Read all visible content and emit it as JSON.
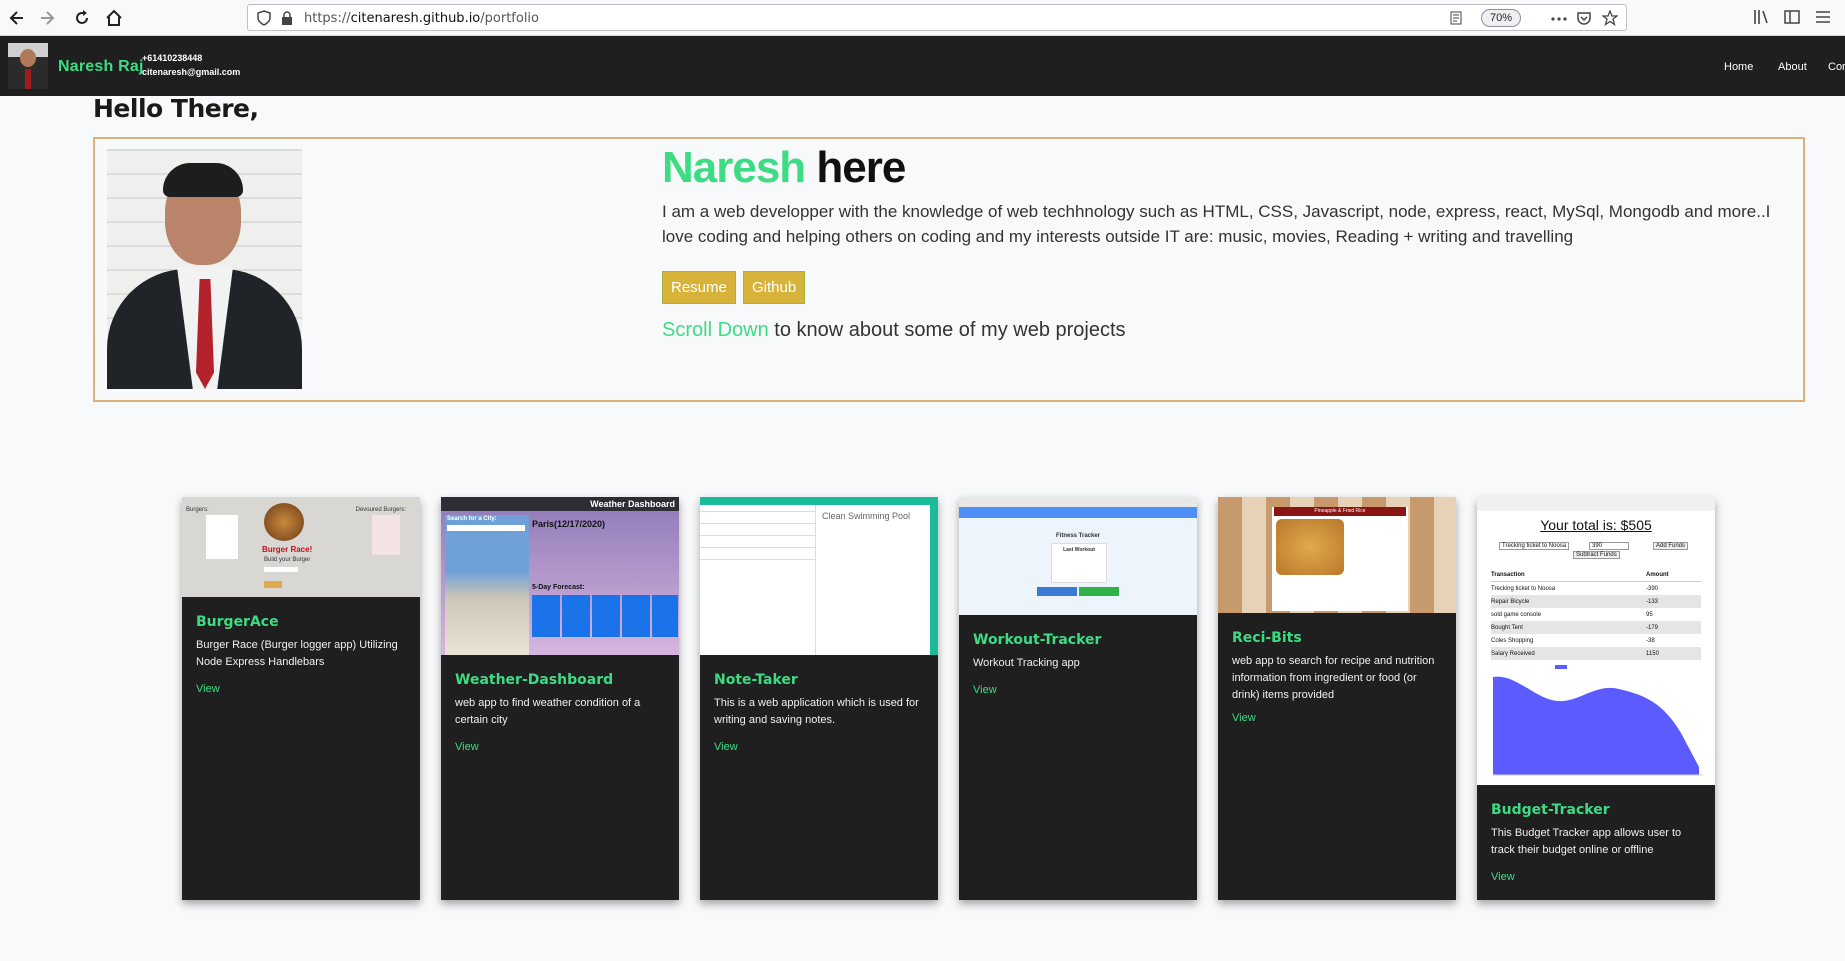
{
  "browser": {
    "url_prefix": "https://",
    "url_domain": "citenaresh.github.io",
    "url_path": "/portfolio",
    "zoom": "70%"
  },
  "navbar": {
    "brand": "Naresh Raj",
    "phone": "+61410238448",
    "email": "citenaresh@gmail.com",
    "links": [
      "Home",
      "About",
      "Cor"
    ]
  },
  "greeting": "Hello There,",
  "intro": {
    "first_name": "Naresh",
    "rest": " here",
    "description": "I am a web developper with the knowledge of web techhnology such as HTML, CSS, Javascript, node, express, react, MySql, Mongodb and more..I love coding and helping others on coding and my interests outside IT are: music, movies, Reading + writing and travelling",
    "resume_label": "Resume",
    "github_label": "Github",
    "scroll_highlight": "Scroll Down",
    "scroll_rest": " to know about some of my web projects"
  },
  "projects": [
    {
      "title": "BurgerAce",
      "description": "Burger Race (Burger logger app) Utilizing Node Express Handlebars",
      "link": "View",
      "thumb": {
        "left_label": "Burgers:",
        "right_label": "Devoured Burgers:",
        "banner": "Burger Race!",
        "subtitle": "Build your Burger"
      }
    },
    {
      "title": "Weather-Dashboard",
      "description": "web app to find weather condition of a certain city",
      "link": "View",
      "thumb": {
        "header": "Weather Dashboard",
        "search_label": "Search for a City:",
        "city": "Paris(12/17/2020)",
        "forecast": "5-Day Forecast:"
      }
    },
    {
      "title": "Note-Taker",
      "description": "This is a web application which is used for writing and saving notes.",
      "link": "View",
      "thumb": {
        "note_title": "Clean Swimming Pool"
      }
    },
    {
      "title": "Workout-Tracker",
      "description": "Workout Tracking app",
      "link": "View",
      "thumb": {
        "app_title": "Fitness Tracker",
        "panel_title": "Last Workout"
      }
    },
    {
      "title": "Reci-Bits",
      "description": "web app to search for recipe and nutrition information from ingredient or food (or drink) items provided",
      "link": "View",
      "thumb": {
        "popup_title": "Pineapple & Fried Rice"
      }
    },
    {
      "title": "Budget-Tracker",
      "description": "This Budget Tracker app allows user to track their budget online or offline",
      "link": "View",
      "thumb": {
        "total": "Your total is: $505",
        "input_name": "Trecking ticket to Noosa",
        "input_amount": "390",
        "add_btn": "Add Funds",
        "sub_btn": "Subtract Funds",
        "col_transaction": "Transaction",
        "col_amount": "Amount",
        "rows": [
          [
            "Trecking ticket to Noosa",
            "-390"
          ],
          [
            "Repair Bicycle",
            "-133"
          ],
          [
            "sold game console",
            "95"
          ],
          [
            "Bought Tent",
            "-179"
          ],
          [
            "Coles Shopping",
            "-38"
          ],
          [
            "Salary Received",
            "1150"
          ]
        ]
      }
    }
  ],
  "colors": {
    "accent": "#3ddc84",
    "navbar_bg": "#1f1f1f",
    "card_bg": "#1f1f1f",
    "intro_border": "#d9b277",
    "button_bg": "#d8b33a"
  }
}
